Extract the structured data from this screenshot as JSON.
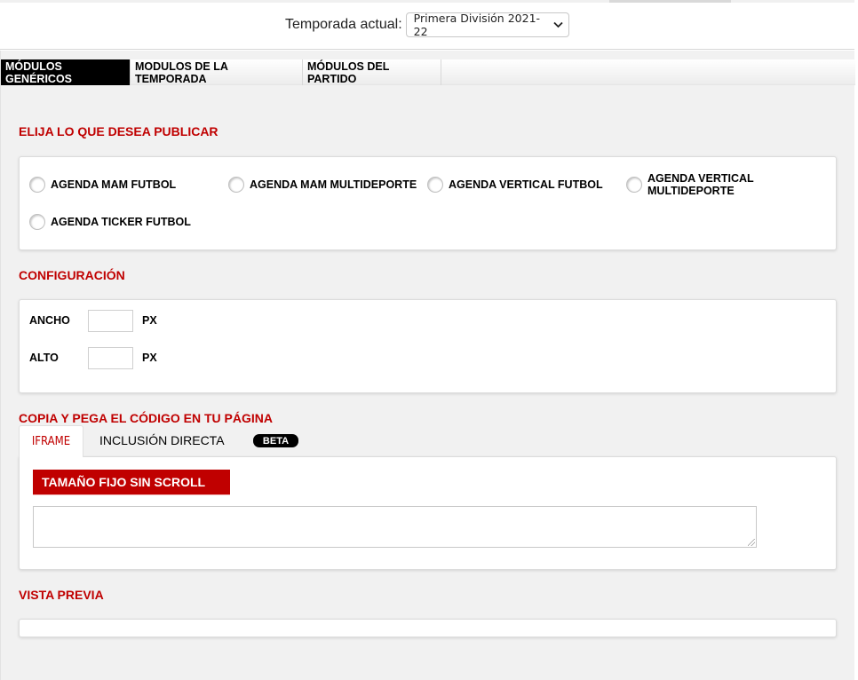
{
  "header": {
    "season_label": "Temporada actual:",
    "season_selected": "Primera División 2021-22"
  },
  "module_tabs": [
    {
      "label": "MÓDULOS GENÉRICOS",
      "active": true
    },
    {
      "label": "MODULOS DE LA TEMPORADA",
      "active": false
    },
    {
      "label": "MÓDULOS DEL PARTIDO",
      "active": false
    }
  ],
  "publish": {
    "title": "ELIJA LO QUE DESEA PUBLICAR",
    "options": [
      "AGENDA MAM FUTBOL",
      "AGENDA MAM MULTIDEPORTE",
      "AGENDA VERTICAL FUTBOL",
      "AGENDA VERTICAL\nMULTIDEPORTE",
      "AGENDA TICKER FUTBOL"
    ]
  },
  "config": {
    "title": "CONFIGURACIÓN",
    "width_label": "ANCHO",
    "width_value": "",
    "width_unit": "PX",
    "height_label": "ALTO",
    "height_value": "",
    "height_unit": "PX"
  },
  "code": {
    "title": "COPIA Y PEGA EL CÓDIGO EN TU PÁGINA",
    "tabs": [
      "IFRAME",
      "INCLUSIÓN DIRECTA"
    ],
    "beta_badge": "BETA",
    "mode_label": "TAMAÑO FIJO SIN SCROLL",
    "code_value": ""
  },
  "preview": {
    "title": "VISTA PREVIA"
  },
  "colors": {
    "accent_red": "#c00000",
    "active_tab_bg": "#000000",
    "panel_bg": "#f1f1f1"
  },
  "icons": {
    "select_arrow": "chevron-down-icon",
    "radio": "radio-icon",
    "resize": "resize-grip-icon"
  }
}
